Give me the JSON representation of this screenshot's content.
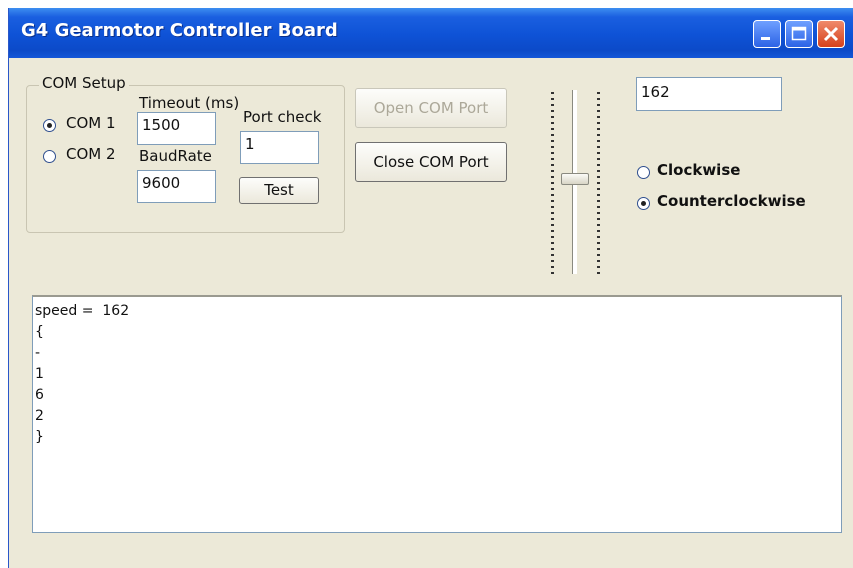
{
  "window": {
    "title": "G4 Gearmotor Controller Board"
  },
  "com_setup": {
    "group_label": "COM Setup",
    "timeout_label": "Timeout (ms)",
    "timeout_value": "1500",
    "baudrate_label": "BaudRate",
    "baudrate_value": "9600",
    "port_check_label": "Port check",
    "port_check_value": "1",
    "test_button": "Test",
    "com1_label": "COM 1",
    "com2_label": "COM 2",
    "selected_port": "COM 1"
  },
  "buttons": {
    "open_com_port": "Open COM Port",
    "close_com_port": "Close COM Port"
  },
  "speed": {
    "value": "162",
    "slider_level_fraction": 0.52
  },
  "direction": {
    "clockwise_label": "Clockwise",
    "counterclockwise_label": "Counterclockwise",
    "selected": "Counterclockwise"
  },
  "output": {
    "lines": [
      "speed =  162",
      "{",
      "-",
      "1",
      "6",
      "2",
      "}"
    ]
  },
  "icons": {
    "minimize": "minimize-icon",
    "maximize": "maximize-icon",
    "close": "close-icon"
  },
  "colors": {
    "titlebar": "#0e52d6",
    "window_face": "#ece9d8",
    "close_button": "#d6411c"
  }
}
